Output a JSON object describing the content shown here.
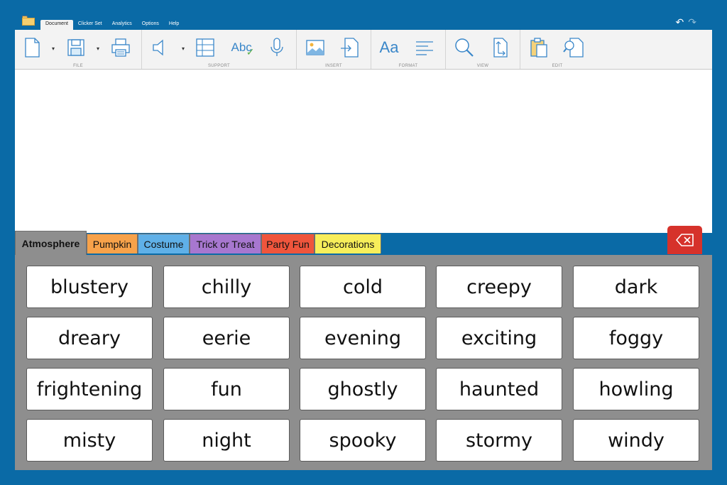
{
  "menu": {
    "items": [
      {
        "label": "Document",
        "active": true
      },
      {
        "label": "Clicker Set",
        "active": false
      },
      {
        "label": "Analytics",
        "active": false
      },
      {
        "label": "Options",
        "active": false
      },
      {
        "label": "Help",
        "active": false
      }
    ],
    "undo_icon": "undo-icon",
    "redo_icon": "redo-icon"
  },
  "ribbon": {
    "groups": {
      "file": "FILE",
      "support": "SUPPORT",
      "insert": "INSERT",
      "format": "FORMAT",
      "view": "VIEW",
      "edit": "EDIT"
    },
    "format_label": "Aa",
    "spell_label": "Abc"
  },
  "tabs": [
    {
      "label": "Atmosphere",
      "color": "#8e8e8e",
      "active": true
    },
    {
      "label": "Pumpkin",
      "color": "#f7a24a",
      "active": false
    },
    {
      "label": "Costume",
      "color": "#5fb0e8",
      "active": false
    },
    {
      "label": "Trick or Treat",
      "color": "#a777cf",
      "active": false
    },
    {
      "label": "Party Fun",
      "color": "#ef553c",
      "active": false
    },
    {
      "label": "Decorations",
      "color": "#f7ee5a",
      "active": false
    }
  ],
  "words": [
    "blustery",
    "chilly",
    "cold",
    "creepy",
    "dark",
    "dreary",
    "eerie",
    "evening",
    "exciting",
    "foggy",
    "frightening",
    "fun",
    "ghostly",
    "haunted",
    "howling",
    "misty",
    "night",
    "spooky",
    "stormy",
    "windy"
  ],
  "colors": {
    "background": "#0a6aa6",
    "grid": "#8e8e8e",
    "backspace": "#d6322b",
    "icon": "#3a87c9"
  }
}
